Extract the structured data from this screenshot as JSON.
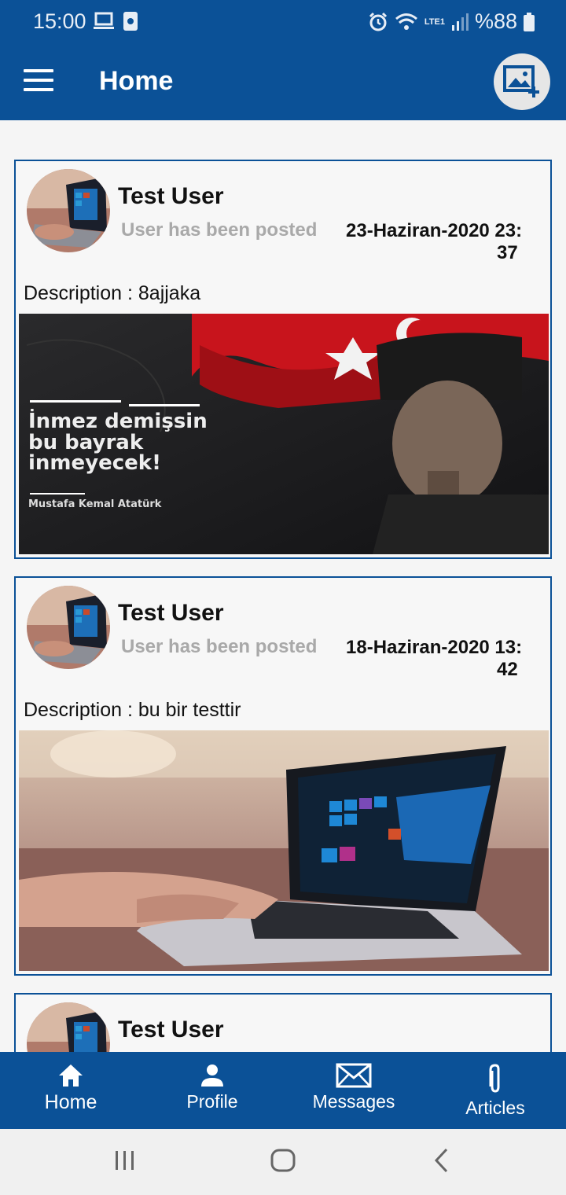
{
  "status_bar": {
    "time": "15:00",
    "battery_text": "%88",
    "network_label": "LTE1"
  },
  "app_bar": {
    "title": "Home",
    "menu_icon": "hamburger-menu-icon",
    "action_icon": "add-photo-icon"
  },
  "posts": [
    {
      "user_name": "Test User",
      "posted_text": "User has been posted",
      "date": "23-Haziran-2020  23:",
      "time": "37",
      "description": "Description : 8ajjaka",
      "image": {
        "line1": "İnmez demişsin",
        "line2": "bu bayrak",
        "line3": "inmeyecek!",
        "signature": "Mustafa Kemal Atatürk"
      }
    },
    {
      "user_name": "Test User",
      "posted_text": "User has been posted",
      "date": "18-Haziran-2020  13:",
      "time": "42",
      "description": "Description :  bu bir testtir"
    },
    {
      "user_name": "Test User"
    }
  ],
  "bottom_nav": {
    "items": [
      {
        "label": "Home",
        "icon": "home-icon"
      },
      {
        "label": "Profile",
        "icon": "person-icon"
      },
      {
        "label": "Messages",
        "icon": "envelope-icon"
      },
      {
        "label": "Articles",
        "icon": "paperclip-icon"
      }
    ]
  },
  "colors": {
    "primary": "#0b5197",
    "muted_text": "#a9a9a9",
    "background": "#f5f5f5"
  }
}
